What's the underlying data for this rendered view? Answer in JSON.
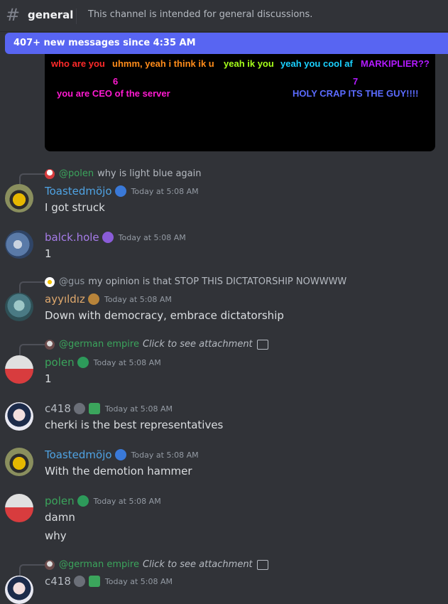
{
  "channel": {
    "name": "general",
    "topic": "This channel is intended for general discussions."
  },
  "new_messages_bar": "407+ new messages since 4:35 AM",
  "embed": {
    "memes": [
      {
        "text": "who are you",
        "color": "#ff2a2a"
      },
      {
        "text": "uhmm, yeah i think ik u",
        "color": "#ff8c1a"
      },
      {
        "text": "yeah ik you",
        "color": "#a6ff1a"
      },
      {
        "text": "yeah you cool af",
        "color": "#1ad1ff"
      },
      {
        "text": "MARKIPLIER??",
        "color": "#b21aff"
      },
      {
        "text": "6",
        "color": "#ff1ad1"
      },
      {
        "text": "you are CEO of the server",
        "color": "#ff1ad1"
      },
      {
        "text": "7",
        "color": "#b21aff"
      },
      {
        "text": "HOLY CRAP ITS THE GUY!!!!",
        "color": "#5b6bff"
      }
    ]
  },
  "messages": [
    {
      "reply": {
        "user": "@polen",
        "text": "why is light blue again",
        "user_color": "#3ba55c"
      },
      "author": "Toastedmöjo",
      "author_color": "#4fa3e3",
      "badge": "blue-creature-badge-icon",
      "time": "Today at 5:08 AM",
      "lines": [
        "I got struck"
      ]
    },
    {
      "author": "balck.hole",
      "author_color": "#a67ce8",
      "badge": "purple-creature-badge-icon",
      "time": "Today at 5:08 AM",
      "lines": [
        "1"
      ]
    },
    {
      "reply": {
        "user": "@gus",
        "text": "my opinion is that STOP THIS DICTATORSHIP NOWWWW",
        "user_color": "#949ba4"
      },
      "author": "ayyıldız",
      "author_color": "#e0a96d",
      "badge": "bronze-creature-badge-icon",
      "time": "Today at 5:08 AM",
      "lines": [
        "Down with democracy, embrace dictatorship"
      ]
    },
    {
      "reply": {
        "user": "@german empire",
        "text": "Click to see attachment",
        "user_color": "#3ba55c"
      },
      "author": "polen",
      "author_color": "#3ba55c",
      "badge": "green-creature-badge-icon",
      "time": "Today at 5:08 AM",
      "lines": [
        "1"
      ]
    },
    {
      "author": "c418",
      "author_color": "#b5bac1",
      "badge": "grey-creature-badge-icon",
      "time": "Today at 5:08 AM",
      "lines": [
        "cherki is the best representatives"
      ]
    },
    {
      "author": "Toastedmöjo",
      "author_color": "#4fa3e3",
      "badge": "blue-creature-badge-icon",
      "time": "Today at 5:08 AM",
      "lines": [
        "With the demotion hammer"
      ]
    },
    {
      "author": "polen",
      "author_color": "#3ba55c",
      "badge": "green-creature-badge-icon",
      "time": "Today at 5:08 AM",
      "lines": [
        "damn",
        "why"
      ]
    },
    {
      "reply": {
        "user": "@german empire",
        "text": "Click to see attachment",
        "user_color": "#3ba55c"
      },
      "author": "c418",
      "author_color": "#b5bac1",
      "badge": "grey-creature-badge-icon",
      "time": "Today at 5:08 AM",
      "lines": []
    }
  ]
}
